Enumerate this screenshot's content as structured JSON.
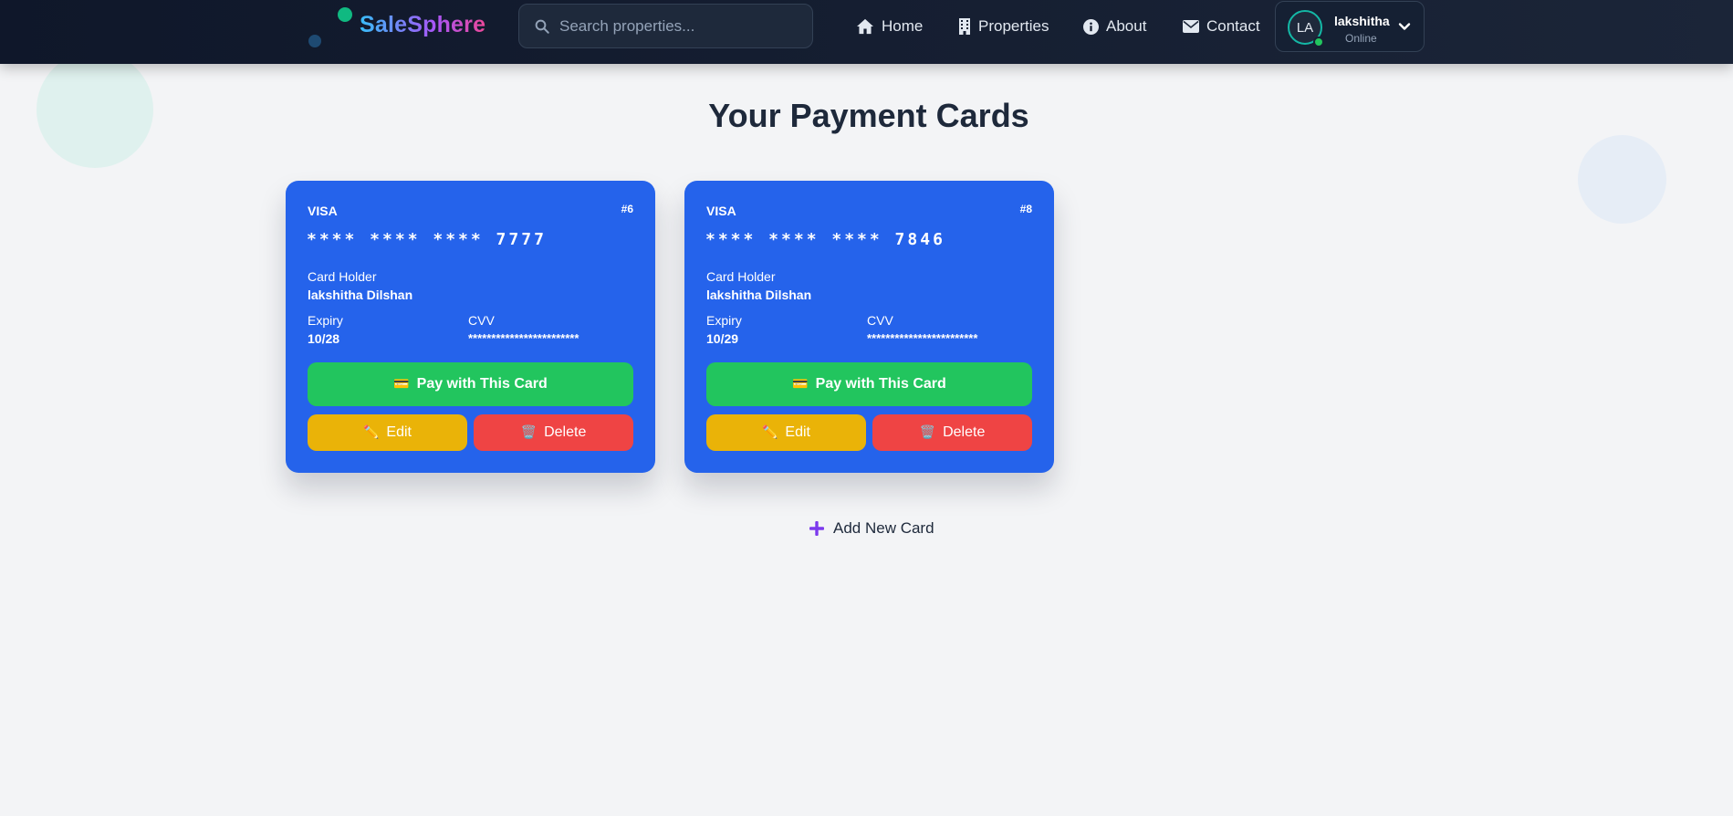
{
  "brand": {
    "name": "SaleSphere"
  },
  "search": {
    "placeholder": "Search properties..."
  },
  "nav": {
    "items": [
      {
        "label": "Home",
        "icon": "home-icon"
      },
      {
        "label": "Properties",
        "icon": "building-icon"
      },
      {
        "label": "About",
        "icon": "info-icon"
      },
      {
        "label": "Contact",
        "icon": "envelope-icon"
      }
    ]
  },
  "user": {
    "initials": "LA",
    "name": "lakshitha",
    "status": "Online"
  },
  "page": {
    "title": "Your Payment Cards",
    "add_card_label": "Add New Card"
  },
  "cards": [
    {
      "brand": "VISA",
      "id": "#6",
      "number": "**** **** **** 7777",
      "holder_label": "Card Holder",
      "holder": "lakshitha Dilshan",
      "expiry_label": "Expiry",
      "expiry": "10/28",
      "cvv_label": "CVV",
      "cvv": "************************",
      "pay_label": "Pay with This Card",
      "edit_label": "Edit",
      "delete_label": "Delete"
    },
    {
      "brand": "VISA",
      "id": "#8",
      "number": "**** **** **** 7846",
      "holder_label": "Card Holder",
      "holder": "lakshitha Dilshan",
      "expiry_label": "Expiry",
      "expiry": "10/29",
      "cvv_label": "CVV",
      "cvv": "************************",
      "pay_label": "Pay with This Card",
      "edit_label": "Edit",
      "delete_label": "Delete"
    }
  ],
  "colors": {
    "navbar": "#0f172a",
    "card": "#2563eb",
    "pay": "#22c55e",
    "edit": "#eab308",
    "delete": "#ef4444",
    "add_icon": "#7c3aed"
  }
}
